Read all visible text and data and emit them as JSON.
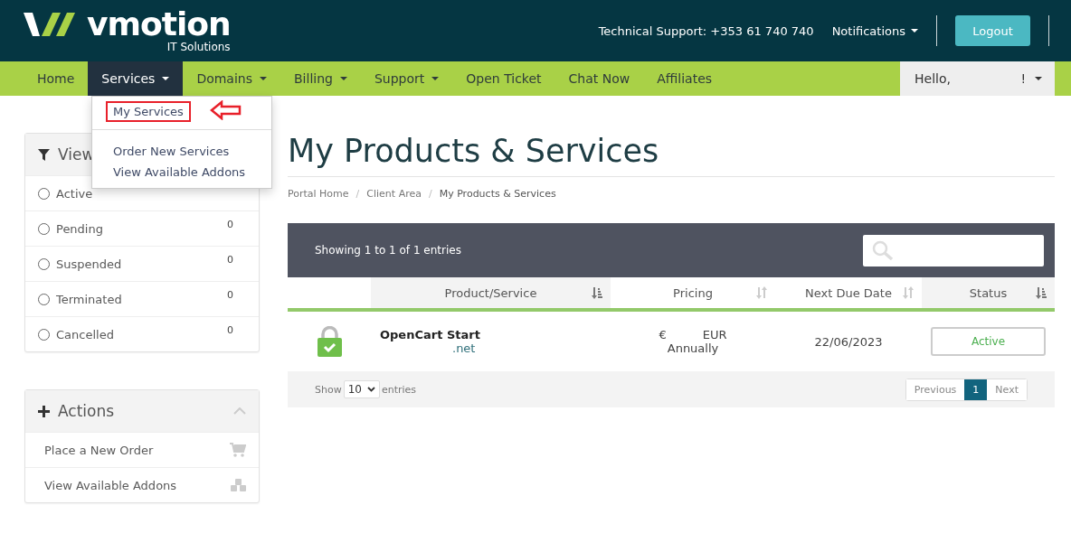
{
  "brand": {
    "name": "vmotion",
    "tagline": "IT Solutions"
  },
  "topbar": {
    "support": "Technical Support: +353 61 740 740",
    "notifications": "Notifications",
    "logout": "Logout"
  },
  "nav": {
    "items": [
      {
        "label": "Home",
        "dropdown": false,
        "selected": false
      },
      {
        "label": "Services",
        "dropdown": true,
        "selected": true
      },
      {
        "label": "Domains",
        "dropdown": true,
        "selected": false
      },
      {
        "label": "Billing",
        "dropdown": true,
        "selected": false
      },
      {
        "label": "Support",
        "dropdown": true,
        "selected": false
      },
      {
        "label": "Open Ticket",
        "dropdown": false,
        "selected": false
      },
      {
        "label": "Chat Now",
        "dropdown": false,
        "selected": false
      },
      {
        "label": "Affiliates",
        "dropdown": false,
        "selected": false
      }
    ],
    "user": {
      "hello": "Hello,",
      "mark": "!"
    }
  },
  "services_menu": {
    "items": [
      {
        "label": "My Services",
        "highlighted": true
      },
      {
        "label": "Order New Services",
        "highlighted": false
      },
      {
        "label": "View Available Addons",
        "highlighted": false
      }
    ]
  },
  "view_filter": {
    "title": "View",
    "items": [
      {
        "label": "Active",
        "selected": false
      },
      {
        "label": "Pending",
        "count": "0",
        "selected": false
      },
      {
        "label": "Suspended",
        "count": "0",
        "selected": false
      },
      {
        "label": "Terminated",
        "count": "0",
        "selected": false
      },
      {
        "label": "Cancelled",
        "count": "0",
        "selected": false
      }
    ]
  },
  "actions": {
    "title": "Actions",
    "items": [
      {
        "label": "Place a New Order",
        "kind": "order"
      },
      {
        "label": "View Available Addons",
        "kind": "addons"
      }
    ]
  },
  "page": {
    "title": "My Products & Services",
    "breadcrumb": [
      "Portal Home",
      "Client Area",
      "My Products & Services"
    ],
    "breadcrumb_separator": "/"
  },
  "table": {
    "info": "Showing 1 to 1 of 1 entries",
    "columns": [
      {
        "label": "Product/Service",
        "sorted": true
      },
      {
        "label": "Pricing",
        "sorted": false
      },
      {
        "label": "Next Due Date",
        "sorted": false
      },
      {
        "label": "Status",
        "sorted": true
      }
    ],
    "rows": [
      {
        "product": "OpenCart Start",
        "domain": ".net",
        "currency_symbol": "€",
        "currency": "EUR",
        "cycle": "Annually",
        "due": "22/06/2023",
        "status": "Active"
      }
    ],
    "footer": {
      "show": "Show",
      "length": "10",
      "entries": "entries",
      "previous": "Previous",
      "page": "1",
      "next": "Next"
    }
  }
}
